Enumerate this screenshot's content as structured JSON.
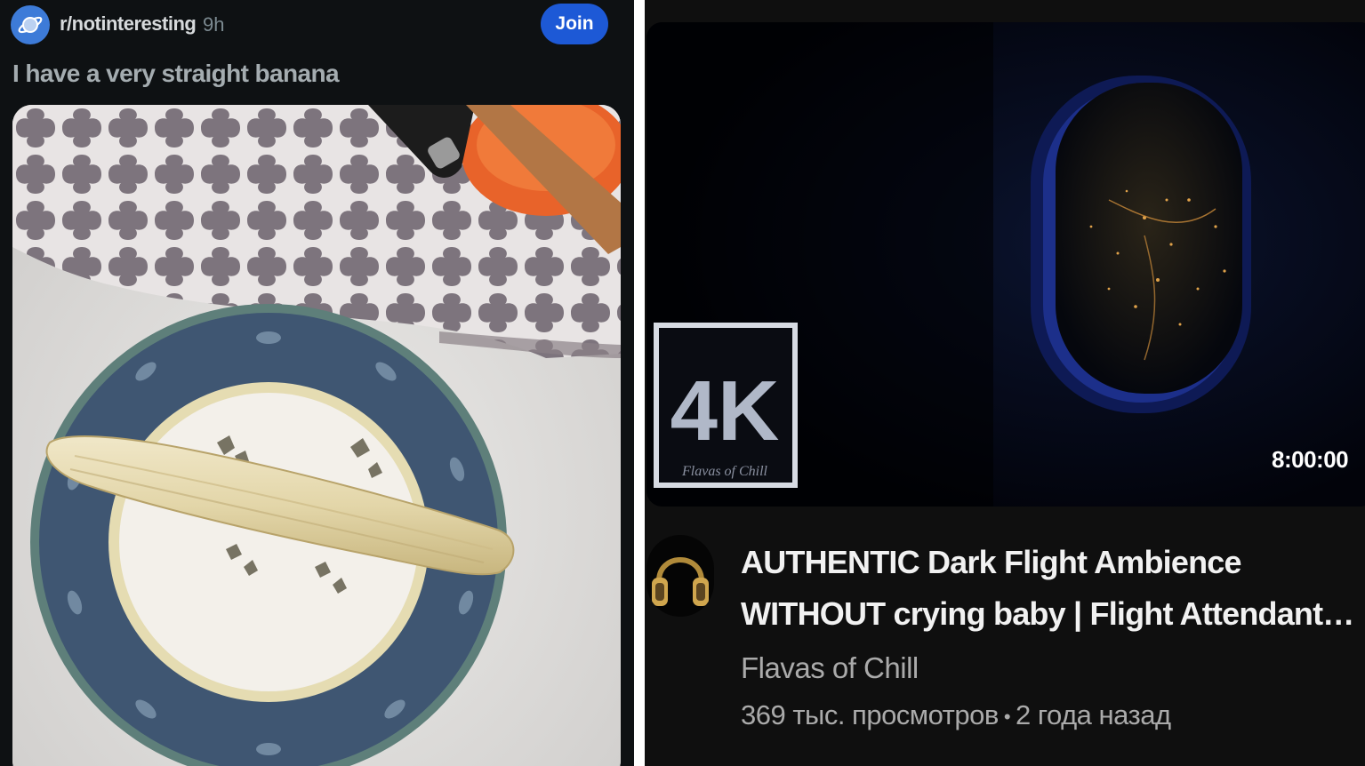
{
  "reddit": {
    "subreddit": "r/notinteresting",
    "time_ago": "9h",
    "join_label": "Join",
    "post_title": "I have a very straight banana",
    "avatar_icon": "planet-icon",
    "accent_color": "#1d59d6"
  },
  "youtube": {
    "badge_text": "4K",
    "badge_watermark": "Flavas of Chill",
    "duration": "8:00:00",
    "title_line1": "AUTHENTIC Dark Flight Ambience",
    "title_line2": "WITHOUT crying baby | Flight Attendant…",
    "channel_name": "Flavas of Chill",
    "views": "369 тыс. просмотров",
    "separator": "•",
    "uploaded": "2 года назад",
    "channel_avatar_icon": "headphones-icon"
  }
}
